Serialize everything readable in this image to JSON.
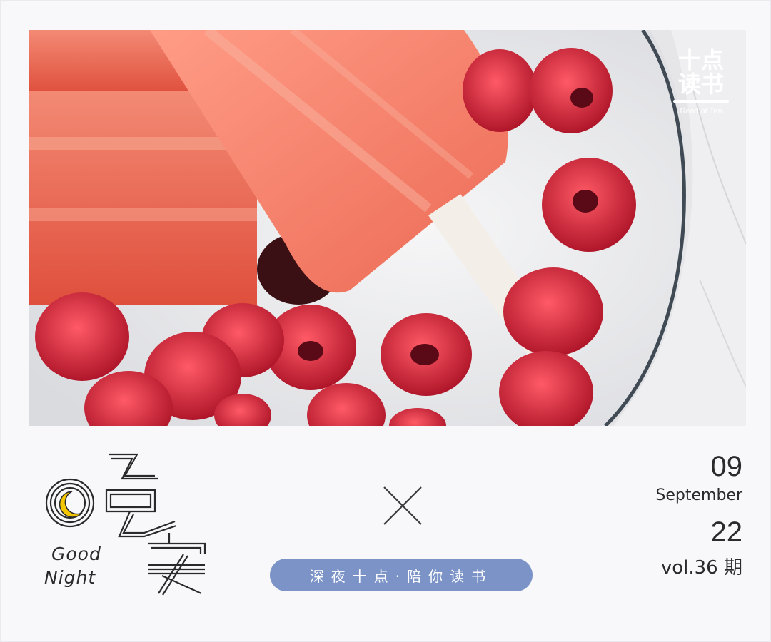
{
  "brand": {
    "line1": "十点",
    "line2": "读书",
    "subtitle": "Read at Ten"
  },
  "greeting": {
    "art": "晚安",
    "english_line1": "Good",
    "english_line2": "Night",
    "icon": "crescent-moon-icon"
  },
  "slogan": "深夜十点·陪你读书",
  "date": {
    "month": "09",
    "month_name": "September",
    "day": "22",
    "volume": "vol.36 期"
  },
  "colors": {
    "slogan_bg": "#7b93c6",
    "moon": "#f4c600",
    "text": "#2b2b2b"
  }
}
